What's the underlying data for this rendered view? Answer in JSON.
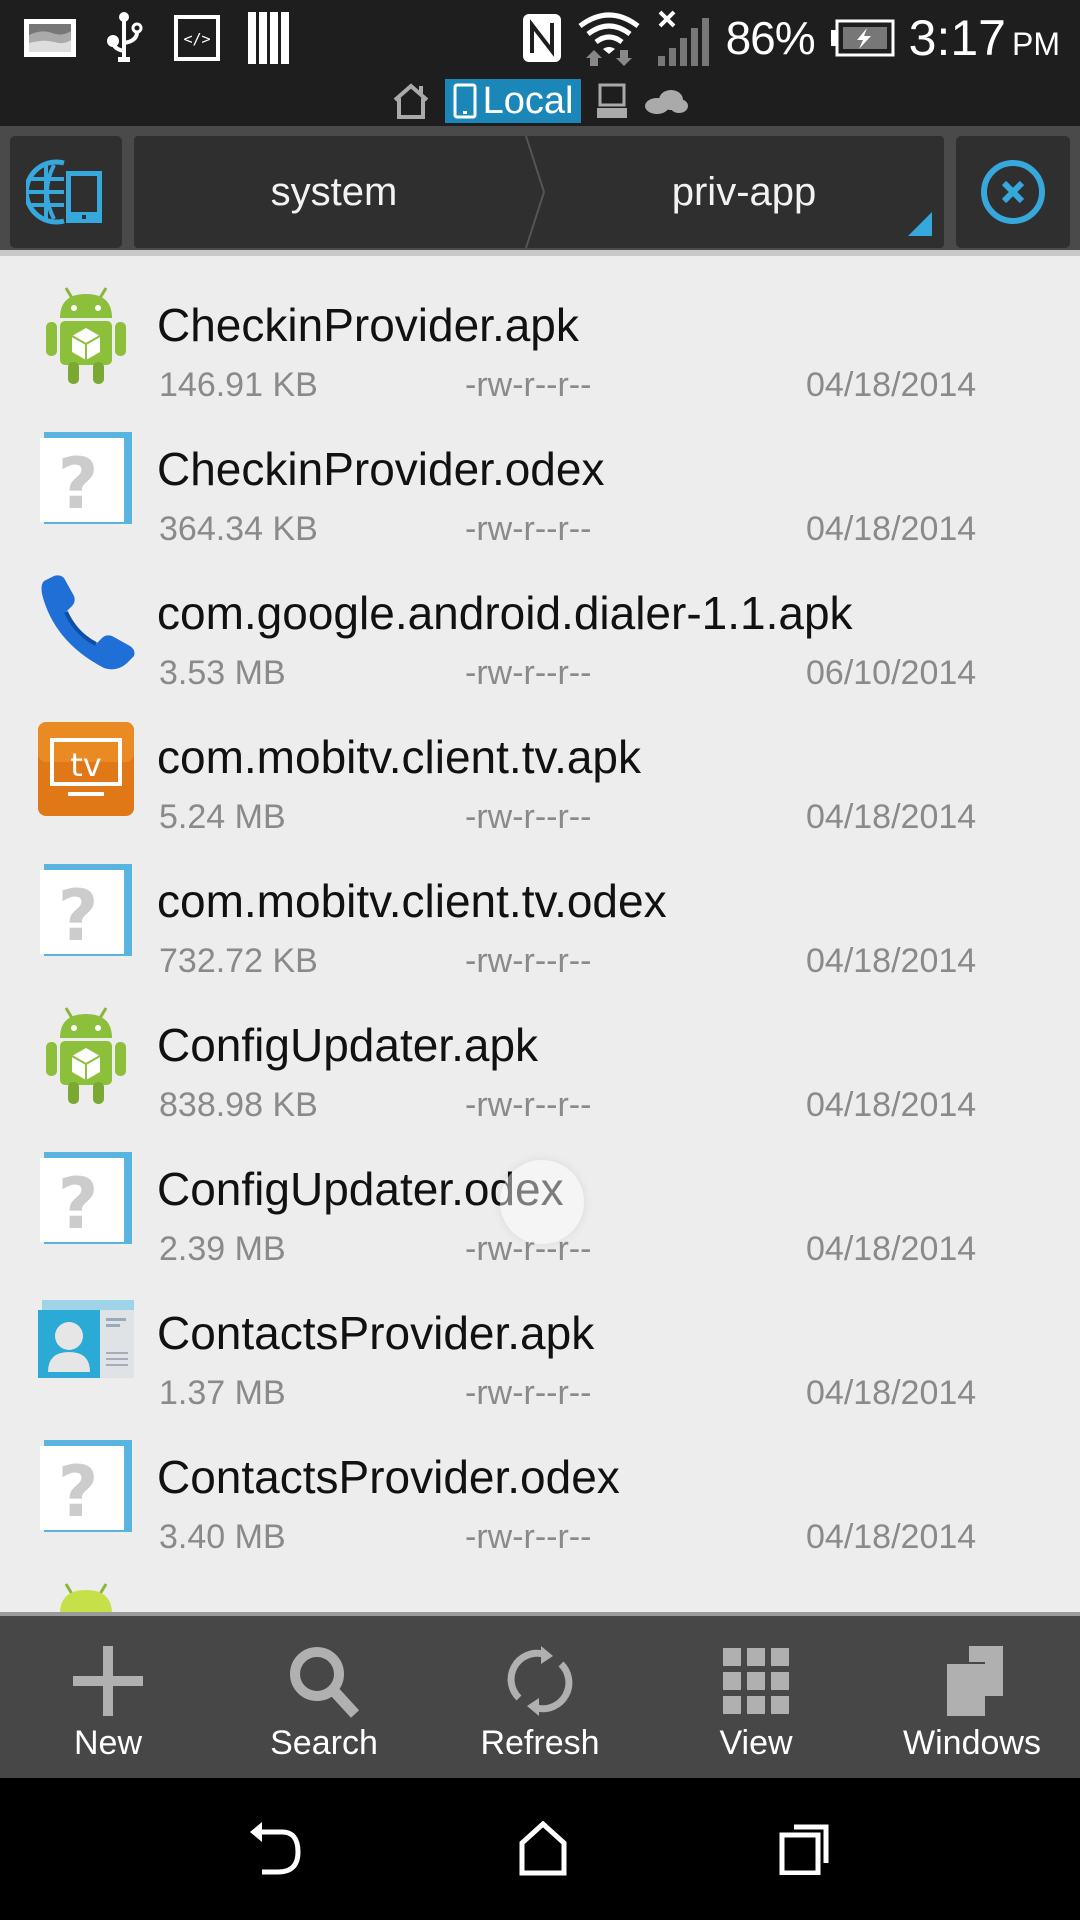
{
  "status_bar": {
    "notification_icons": [
      "gallery-icon",
      "usb-icon",
      "developer-code-icon",
      "barcode-icon"
    ],
    "system_icons": [
      "nfc-icon",
      "wifi-icon",
      "signal-no-service-icon"
    ],
    "battery_percent": "86%",
    "battery_state": "charging",
    "time": "3:17",
    "ampm": "PM"
  },
  "location_bar": {
    "items": [
      {
        "name": "home",
        "icon": "home-icon",
        "label": ""
      },
      {
        "name": "local",
        "icon": "phone-icon",
        "label": "Local",
        "active": true
      },
      {
        "name": "network",
        "icon": "laptop-icon",
        "label": ""
      },
      {
        "name": "cloud",
        "icon": "cloud-icon",
        "label": ""
      }
    ],
    "accent_color": "#1a87b8"
  },
  "path_bar": {
    "left_button_icon": "globe-phone-icon",
    "crumbs": [
      "system",
      "priv-app"
    ],
    "close_icon": "close-circle-icon",
    "accent_color": "#37a8dc"
  },
  "files": [
    {
      "name": "CheckinProvider.apk",
      "size": "146.91 KB",
      "perm": "-rw-r--r--",
      "date": "04/18/2014",
      "icon": "android-apk-icon"
    },
    {
      "name": "CheckinProvider.odex",
      "size": "364.34 KB",
      "perm": "-rw-r--r--",
      "date": "04/18/2014",
      "icon": "unknown-file-icon"
    },
    {
      "name": "com.google.android.dialer-1.1.apk",
      "size": "3.53 MB",
      "perm": "-rw-r--r--",
      "date": "06/10/2014",
      "icon": "phone-dialer-icon"
    },
    {
      "name": "com.mobitv.client.tv.apk",
      "size": "5.24 MB",
      "perm": "-rw-r--r--",
      "date": "04/18/2014",
      "icon": "tv-app-icon"
    },
    {
      "name": "com.mobitv.client.tv.odex",
      "size": "732.72 KB",
      "perm": "-rw-r--r--",
      "date": "04/18/2014",
      "icon": "unknown-file-icon"
    },
    {
      "name": "ConfigUpdater.apk",
      "size": "838.98 KB",
      "perm": "-rw-r--r--",
      "date": "04/18/2014",
      "icon": "android-apk-icon"
    },
    {
      "name": "ConfigUpdater.odex",
      "size": "2.39 MB",
      "perm": "-rw-r--r--",
      "date": "04/18/2014",
      "icon": "unknown-file-icon"
    },
    {
      "name": "ContactsProvider.apk",
      "size": "1.37 MB",
      "perm": "-rw-r--r--",
      "date": "04/18/2014",
      "icon": "contacts-app-icon"
    },
    {
      "name": "ContactsProvider.odex",
      "size": "3.40 MB",
      "perm": "-rw-r--r--",
      "date": "04/18/2014",
      "icon": "unknown-file-icon"
    }
  ],
  "toolbar": {
    "new": "New",
    "search": "Search",
    "refresh": "Refresh",
    "view": "View",
    "windows": "Windows"
  },
  "navbar": {
    "back": "back-icon",
    "home": "home-icon",
    "recents": "recents-icon"
  }
}
